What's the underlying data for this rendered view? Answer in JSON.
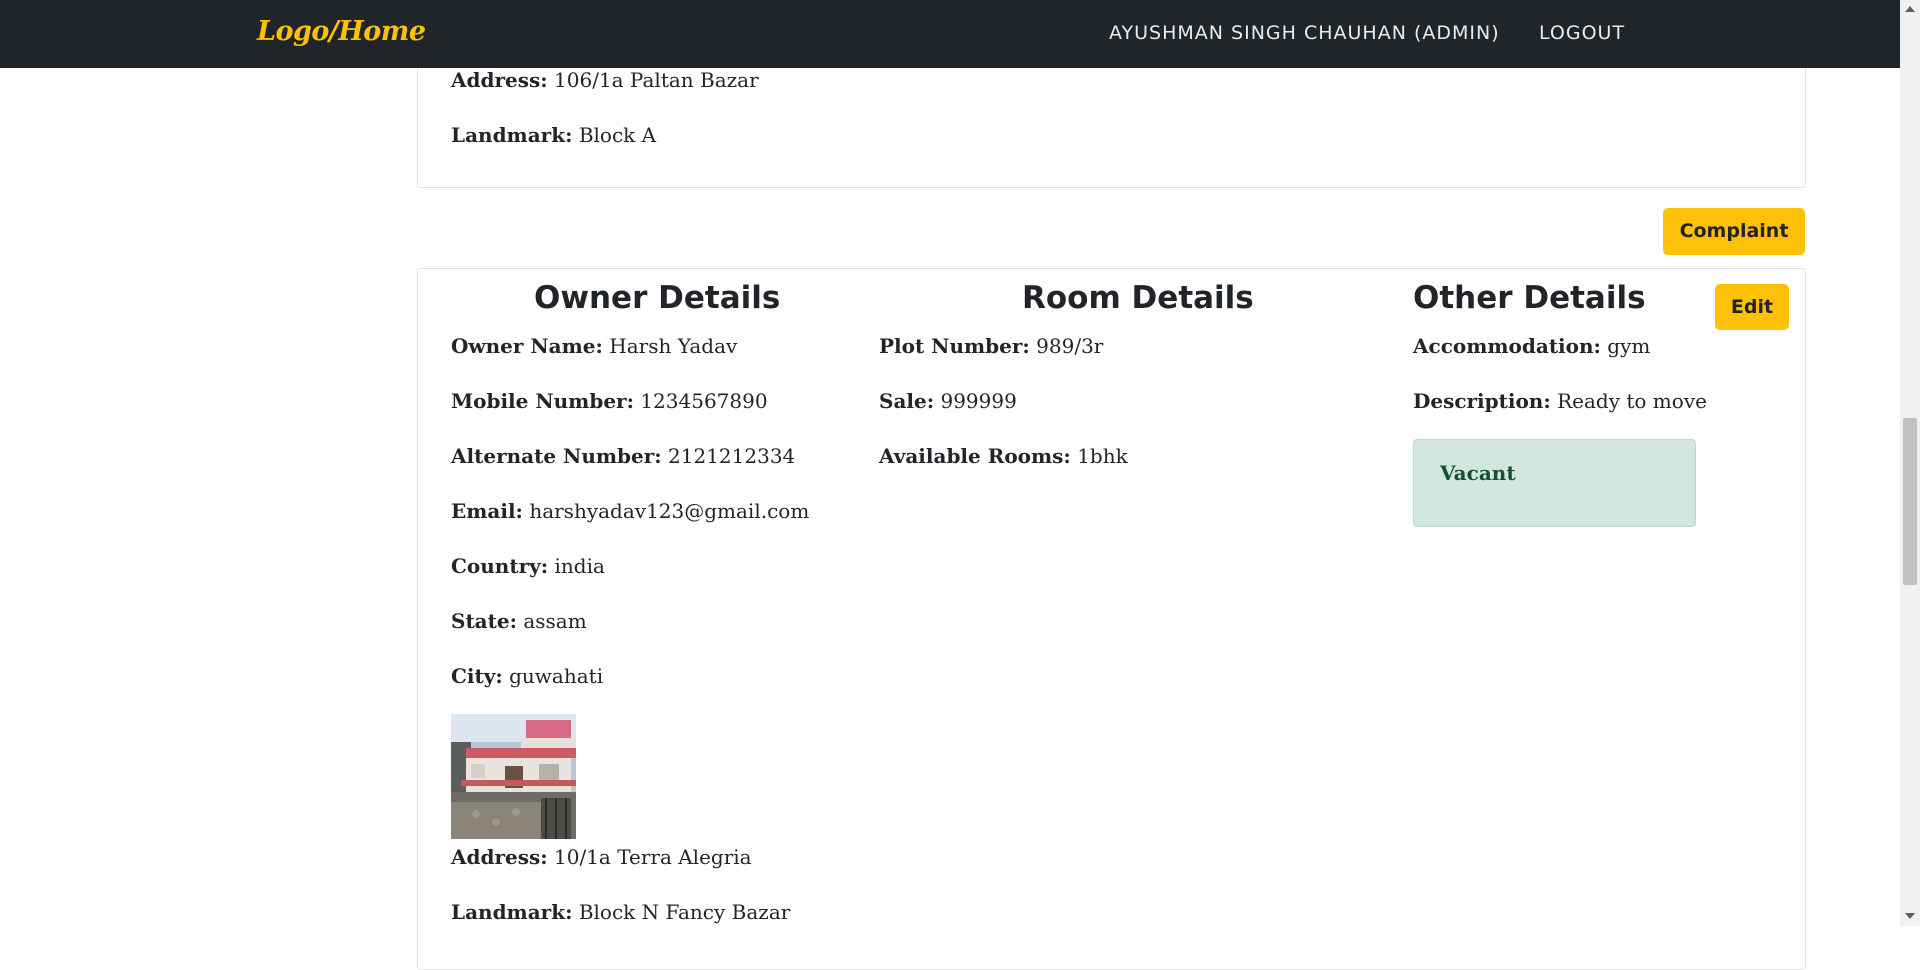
{
  "navbar": {
    "logo": "Logo/Home",
    "user": "AYUSHMAN SINGH CHAUHAN (ADMIN)",
    "logout": "LOGOUT"
  },
  "previous_card": {
    "address_label": "Address:",
    "address_value": "106/1a Paltan Bazar",
    "landmark_label": "Landmark:",
    "landmark_value": "Block A"
  },
  "complaint_button": "Complaint",
  "edit_button": "Edit",
  "owner_details": {
    "heading": "Owner Details",
    "fields": [
      {
        "label": "Owner Name:",
        "value": "Harsh Yadav"
      },
      {
        "label": "Mobile Number:",
        "value": "1234567890"
      },
      {
        "label": "Alternate Number:",
        "value": "2121212334"
      },
      {
        "label": "Email:",
        "value": "harshyadav123@gmail.com"
      },
      {
        "label": "Country:",
        "value": "india"
      },
      {
        "label": "State:",
        "value": "assam"
      },
      {
        "label": "City:",
        "value": "guwahati"
      }
    ],
    "address_label": "Address:",
    "address_value": "10/1a Terra Alegria",
    "landmark_label": "Landmark:",
    "landmark_value": "Block N Fancy Bazar"
  },
  "room_details": {
    "heading": "Room Details",
    "fields": [
      {
        "label": "Plot Number:",
        "value": "989/3r"
      },
      {
        "label": "Sale:",
        "value": "999999"
      },
      {
        "label": "Available Rooms:",
        "value": "1bhk"
      }
    ]
  },
  "other_details": {
    "heading": "Other Details",
    "fields": [
      {
        "label": "Accommodation:",
        "value": "gym"
      },
      {
        "label": "Description:",
        "value": "Ready to move"
      }
    ],
    "status": "Vacant"
  },
  "colors": {
    "navbar_bg": "#212529",
    "accent": "#ffc107",
    "status_bg": "#d1e7dd",
    "status_text": "#0f5132"
  }
}
